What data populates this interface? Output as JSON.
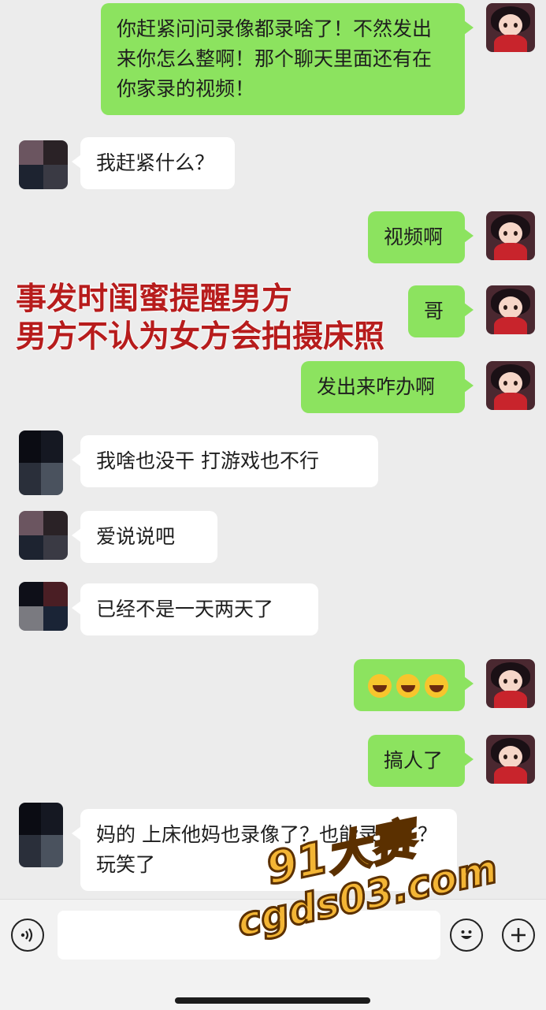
{
  "messages": [
    {
      "side": "out",
      "text": "你赶紧问问录像都录啥了！不然发出来你怎么整啊！那个聊天里面还有在你家录的视频！"
    },
    {
      "side": "in",
      "text": "我赶紧什么？"
    },
    {
      "side": "out",
      "text": "视频啊"
    },
    {
      "side": "out",
      "text": "哥"
    },
    {
      "side": "out",
      "text": "发出来咋办啊"
    },
    {
      "side": "in",
      "text": "我啥也没干  打游戏也不行"
    },
    {
      "side": "in",
      "text": "爱说说吧"
    },
    {
      "side": "in",
      "text": "已经不是一天两天了"
    },
    {
      "side": "out",
      "text": "😂😂😂"
    },
    {
      "side": "out",
      "text": "搞人了"
    },
    {
      "side": "in",
      "text": "妈的  上床他妈也录像了？也能录屏了？玩笑了"
    }
  ],
  "overlay": {
    "line1": "事发时闺蜜提醒男方",
    "line2": "男方不认为女方会拍摄床照"
  },
  "watermark": {
    "line1": "91大赛",
    "line2": "cgds03.com"
  },
  "input_bar": {
    "voice_icon": "voice-icon",
    "emoji_icon": "emoji-icon",
    "plus_icon": "plus-icon"
  }
}
